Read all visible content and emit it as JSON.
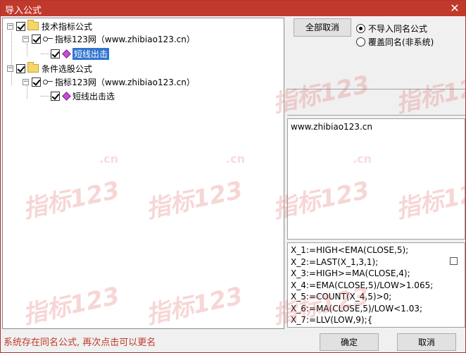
{
  "window": {
    "title": "导入公式",
    "close_label": "✕"
  },
  "tree": {
    "nodes": [
      {
        "label": "技术指标公式"
      },
      {
        "label": "指标123网（www.zhibiao123.cn）"
      },
      {
        "label": "短线出击"
      },
      {
        "label": "条件选股公式"
      },
      {
        "label": "指标123网（www.zhibiao123.cn）"
      },
      {
        "label": "短线出击选"
      }
    ]
  },
  "actions": {
    "cancel_all_label": "全部取消",
    "radio_skip_label": "不导入同名公式",
    "radio_overwrite_label": "覆盖同名(非系统)",
    "selected_radio": "skip"
  },
  "description": {
    "text": "www.zhibiao123.cn"
  },
  "code": {
    "lines": [
      "X_1:=HIGH<EMA(CLOSE,5);",
      "X_2:=LAST(X_1,3,1);",
      "X_3:=HIGH>=MA(CLOSE,4);",
      "X_4:=EMA(CLOSE,5)/LOW>1.065;",
      "X_5:=COUNT(X_4,5)>0;",
      "X_6:=MA(CLOSE,5)/LOW<1.03;",
      "X_7:=LLV(LOW,9);{"
    ]
  },
  "footer": {
    "status": "系统存在同名公式, 再次点击可以更名",
    "ok_label": "确定",
    "cancel_label": "取消"
  },
  "watermark": {
    "text": "指标123",
    "suffix": ".cn"
  },
  "colors": {
    "title_bar": "#c0392b",
    "selection": "#3174d0",
    "status_text": "#c0392b"
  }
}
